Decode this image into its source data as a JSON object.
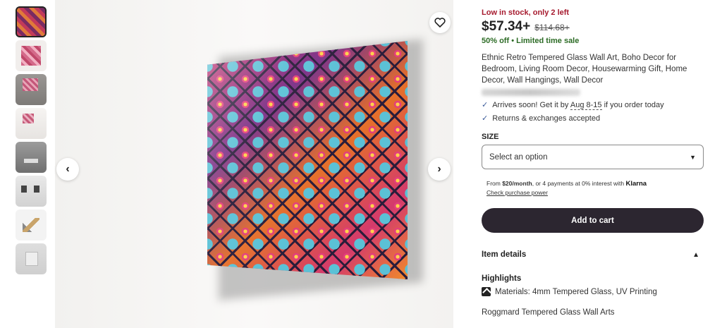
{
  "gallery": {
    "thumbnails": [
      {
        "icon": "product-thumbnail",
        "active": true
      },
      {
        "icon": "product-thumbnail"
      },
      {
        "icon": "room-thumbnail"
      },
      {
        "icon": "room-thumbnail"
      },
      {
        "icon": "wall-thumbnail"
      },
      {
        "icon": "hardware-thumbnail"
      },
      {
        "icon": "hardware-thumbnail"
      },
      {
        "icon": "mount-thumbnail"
      }
    ],
    "prev_icon": "‹",
    "next_icon": "›",
    "favorite_icon": "heart-icon"
  },
  "listing": {
    "stock_notice": "Low in stock, only 2 left",
    "price": "$57.34+",
    "original_price": "$114.68+",
    "discount": "50% off",
    "discount_separator": "•",
    "sale_note": "Limited time sale",
    "title": "Ethnic Retro Tempered Glass Wall Art, Boho Decor for Bedroom, Living Room Decor, Housewarming Gift, Home Decor, Wall Hangings, Wall Decor",
    "delivery": {
      "prefix": "Arrives soon! Get it by ",
      "date": "Aug 8-15",
      "suffix": " if you order today"
    },
    "returns": "Returns & exchanges accepted",
    "check_icon": "✓"
  },
  "size": {
    "label": "SIZE",
    "placeholder": "Select an option",
    "caret": "▼"
  },
  "payment": {
    "from_text": "From ",
    "monthly": "$20/month",
    "installments_text": ", or 4 payments at 0% interest with ",
    "provider": "Klarna",
    "link": "Check purchase power"
  },
  "cart": {
    "button": "Add to cart"
  },
  "details": {
    "header": "Item details",
    "chevron": "▲",
    "highlights_label": "Highlights",
    "materials": "Materials: 4mm Tempered Glass, UV Printing",
    "brand": "Roggmard Tempered Glass Wall Arts"
  }
}
